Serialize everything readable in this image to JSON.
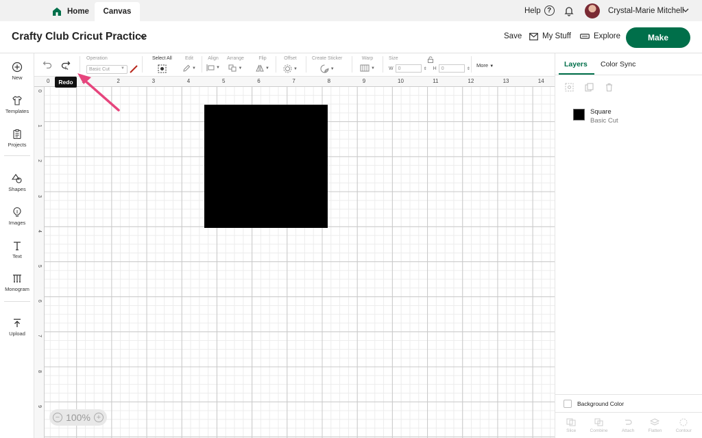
{
  "tabs": {
    "home": "Home",
    "canvas": "Canvas"
  },
  "topbar": {
    "help": "Help",
    "user": "Crystal-Marie Mitchell"
  },
  "header": {
    "title": "Crafty Club Cricut Practice",
    "save": "Save",
    "my_stuff": "My Stuff",
    "explore": "Explore",
    "make": "Make"
  },
  "sidebar": {
    "items": [
      {
        "label": "New",
        "icon": "plus-circle-icon"
      },
      {
        "label": "Templates",
        "icon": "shirt-icon"
      },
      {
        "label": "Projects",
        "icon": "clipboard-icon"
      },
      {
        "label": "Shapes",
        "icon": "shapes-icon"
      },
      {
        "label": "Images",
        "icon": "bulb-icon"
      },
      {
        "label": "Text",
        "icon": "text-icon"
      },
      {
        "label": "Monogram",
        "icon": "monogram-icon"
      },
      {
        "label": "Upload",
        "icon": "upload-icon"
      }
    ]
  },
  "toolbar": {
    "operation_label": "Operation",
    "operation_value": "Basic Cut",
    "select_all": "Select All",
    "edit": "Edit",
    "align": "Align",
    "arrange": "Arrange",
    "flip": "Flip",
    "offset": "Offset",
    "create_sticker": "Create Sticker",
    "warp": "Warp",
    "size": "Size",
    "w_label": "W",
    "w_value": "0",
    "h_label": "H",
    "h_value": "0",
    "more": "More"
  },
  "tooltip": "Redo",
  "ruler": {
    "top": [
      "0",
      "1",
      "2",
      "3",
      "4",
      "5",
      "6",
      "7",
      "8",
      "9",
      "10",
      "11",
      "12",
      "13",
      "14"
    ],
    "left": [
      "0",
      "1",
      "2",
      "3",
      "4",
      "5",
      "6",
      "7",
      "8",
      "9"
    ]
  },
  "zoom": "100%",
  "right_panel": {
    "tabs": {
      "layers": "Layers",
      "color_sync": "Color Sync"
    },
    "layer": {
      "name": "Square",
      "operation": "Basic Cut",
      "color": "#000000"
    },
    "background_color": "Background Color",
    "bottom_actions": [
      "Slice",
      "Combine",
      "Attach",
      "Flatten",
      "Contour"
    ]
  },
  "colors": {
    "brand": "#006f4a",
    "arrow": "#e6457d"
  }
}
